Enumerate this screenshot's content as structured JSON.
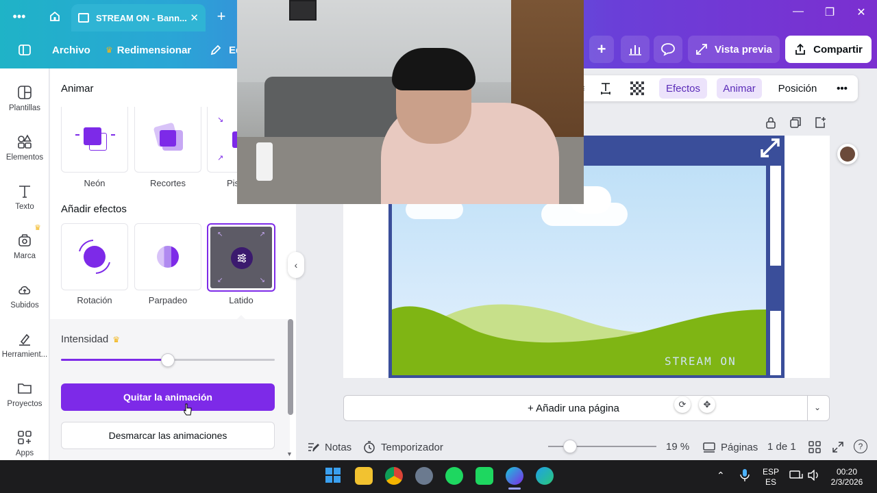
{
  "browser": {
    "tab_title": "STREAM ON - Bann...",
    "tab_close": "✕",
    "new_tab": "+",
    "menu_dots": "•••",
    "win_minimize": "—",
    "win_maximize": "❐",
    "win_close": "✕"
  },
  "header": {
    "file_label": "Archivo",
    "resize_label": "Redimensionar",
    "edit_label": "Ed",
    "preview_label": "Vista previa",
    "share_label": "Compartir",
    "add_label": "+"
  },
  "rail": {
    "items": [
      {
        "label": "Plantillas",
        "icon": "templates-icon"
      },
      {
        "label": "Elementos",
        "icon": "elements-icon"
      },
      {
        "label": "Texto",
        "icon": "text-icon"
      },
      {
        "label": "Marca",
        "icon": "brand-icon"
      },
      {
        "label": "Subidos",
        "icon": "uploads-icon"
      },
      {
        "label": "Herramient...",
        "icon": "tools-icon"
      },
      {
        "label": "Proyectos",
        "icon": "projects-icon"
      },
      {
        "label": "Apps",
        "icon": "apps-icon"
      }
    ]
  },
  "panel": {
    "title": "Animar",
    "top_effects": [
      "Neón",
      "Recortes",
      "Pis"
    ],
    "effects_title": "Añadir efectos",
    "effects": [
      "Rotación",
      "Parpadeo",
      "Latido"
    ],
    "selected_effect": "Latido",
    "intensity_label": "Intensidad",
    "intensity_value": 0.5,
    "remove_animation": "Quitar la animación",
    "unmark_animations": "Desmarcar las animaciones"
  },
  "context_toolbar": {
    "effects": "Efectos",
    "animate": "Animar",
    "position": "Posición",
    "more": "•••"
  },
  "canvas": {
    "design_text": "STREAM ON",
    "add_page": "+ Añadir una página"
  },
  "status": {
    "notes": "Notas",
    "timer": "Temporizador",
    "zoom": "19 %",
    "zoom_value": 0.19,
    "pages": "Páginas",
    "page_count": "1 de 1"
  },
  "taskbar": {
    "lang_top": "ESP",
    "lang_bottom": "ES",
    "time": "00:20",
    "date": "2/3/2026"
  },
  "colors": {
    "accent": "#7d2ae8",
    "frame": "#3a4e9a",
    "grass": "#7fb514"
  }
}
